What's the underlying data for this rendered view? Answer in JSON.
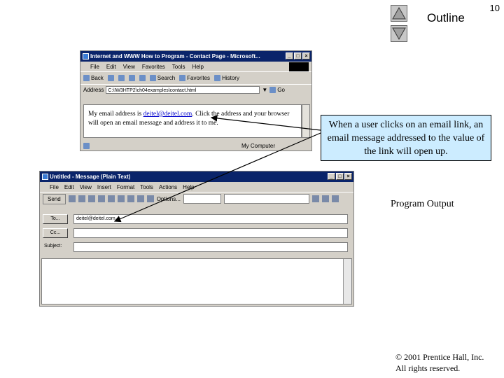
{
  "slide": {
    "page_number": "10",
    "outline_label": "Outline",
    "program_output": "Program Output",
    "copyright_line1": "© 2001 Prentice Hall, Inc.",
    "copyright_line2": "All rights reserved."
  },
  "callout": {
    "text": "When a user clicks on an email link, an email message addressed to the value of the link will open up."
  },
  "browser": {
    "title": "Internet and WWW How to Program - Contact Page - Microsoft...",
    "menu": [
      "File",
      "Edit",
      "View",
      "Favorites",
      "Tools",
      "Help"
    ],
    "toolbar": [
      "Back",
      "Search",
      "Favorites",
      "History"
    ],
    "address_label": "Address",
    "address_value": "C:\\IW3HTP2\\ch04examples\\contact.html",
    "go_label": "Go",
    "content_before": "My email address is ",
    "content_link": "deitel@deitel.com",
    "content_after": ". Click the address and your browser will open an email message and address it to me.",
    "status_zone": "My Computer"
  },
  "mail": {
    "title": "Untitled - Message (Plain Text)",
    "menu": [
      "File",
      "Edit",
      "View",
      "Insert",
      "Format",
      "Tools",
      "Actions",
      "Help"
    ],
    "send_label": "Send",
    "options_label": "Options...",
    "to_button": "To...",
    "cc_button": "Cc...",
    "subject_label": "Subject:",
    "to_value": "deitel@deitel.com"
  }
}
